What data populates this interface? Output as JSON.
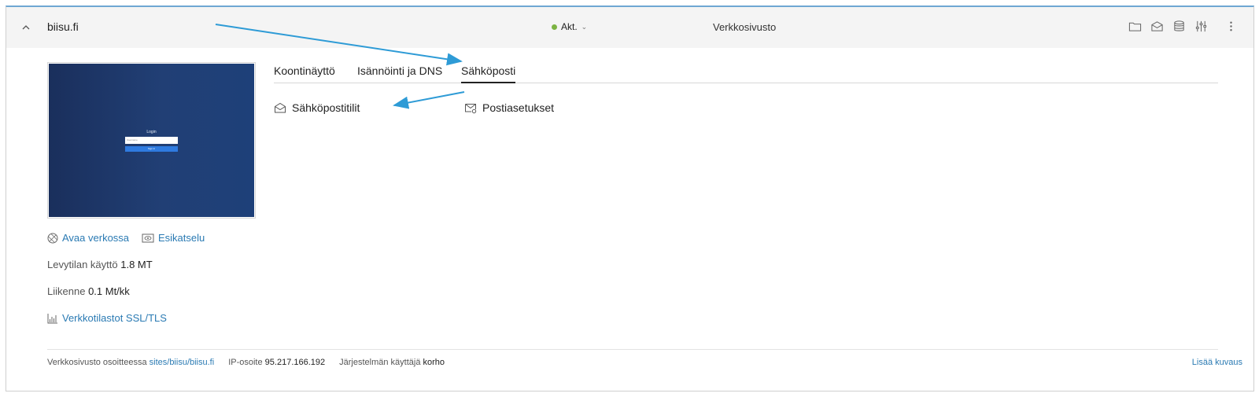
{
  "header": {
    "domain": "biisu.fi",
    "status_label": "Akt.",
    "site_type": "Verkkosivusto",
    "status_color": "#7cb342",
    "icons": [
      "folder-icon",
      "mail-icon",
      "database-icon",
      "settings-sliders-icon",
      "kebab-menu-icon"
    ]
  },
  "thumbnail": {
    "login_title": "Login",
    "input_placeholder": "Username",
    "button_label": "Sign in"
  },
  "left": {
    "open_link": "Avaa verkossa",
    "preview_link": "Esikatselu",
    "disk_label": "Levytilan käyttö",
    "disk_value": "1.8 MT",
    "traffic_label": "Liikenne",
    "traffic_value": "0.1 Mt/kk",
    "stats_link": "Verkkotilastot SSL/TLS"
  },
  "tabs": [
    {
      "label": "Koontinäyttö",
      "active": false
    },
    {
      "label": "Isännöinti ja DNS",
      "active": false
    },
    {
      "label": "Sähköposti",
      "active": true
    }
  ],
  "email": {
    "accounts": "Sähköpostitilit",
    "settings": "Postiasetukset"
  },
  "footer": {
    "site_at_label": "Verkkosivusto osoitteessa",
    "site_path": "sites/biisu/biisu.fi",
    "ip_label": "IP-osoite",
    "ip_value": "95.217.166.192",
    "user_label": "Järjestelmän käyttäjä",
    "user_value": "korho",
    "add_description": "Lisää kuvaus"
  },
  "accent_color": "#2a7ab3",
  "arrow_color": "#2e9bd6"
}
